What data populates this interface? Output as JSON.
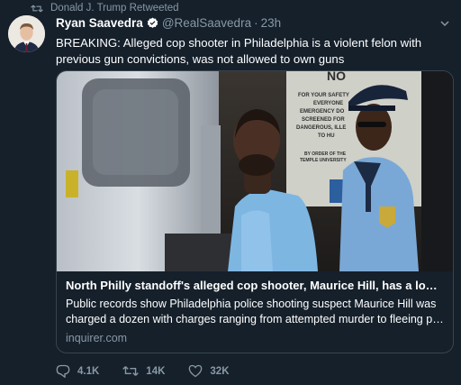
{
  "retweet_context": {
    "text": "Donald J. Trump Retweeted",
    "icon": "retweet-icon"
  },
  "author": {
    "name": "Ryan Saavedra",
    "verified": true,
    "handle": "@RealSaavedra",
    "separator": "·",
    "time": "23h"
  },
  "tweet": {
    "text": "BREAKING: Alleged cop shooter in Philadelphia is a violent felon with previous gun convictions, was not allowed to own guns"
  },
  "card": {
    "image_sign_lines": [
      "NO",
      "FOR YOUR SAFETY",
      "EVERYONE",
      "EMERGENCY DO",
      "SCREENED FOR",
      "DANGEROUS, ILLE",
      "TO HU",
      "BY ORDER OF THE",
      "TEMPLE UNIVERSITY"
    ],
    "title": "North Philly standoff's alleged cop shooter, Maurice Hill, has a long c...",
    "description_line1": "Public records show Philadelphia police shooting suspect Maurice Hill was",
    "description_line2": "charged a dozen with charges ranging from attempted murder to fleeing po...",
    "domain": "inquirer.com"
  },
  "actions": {
    "replies": "4.1K",
    "retweets": "14K",
    "likes": "32K"
  },
  "colors": {
    "background": "#15202b",
    "secondary_text": "#8899a6",
    "verified": "#1da1f2",
    "border": "#38444d"
  }
}
